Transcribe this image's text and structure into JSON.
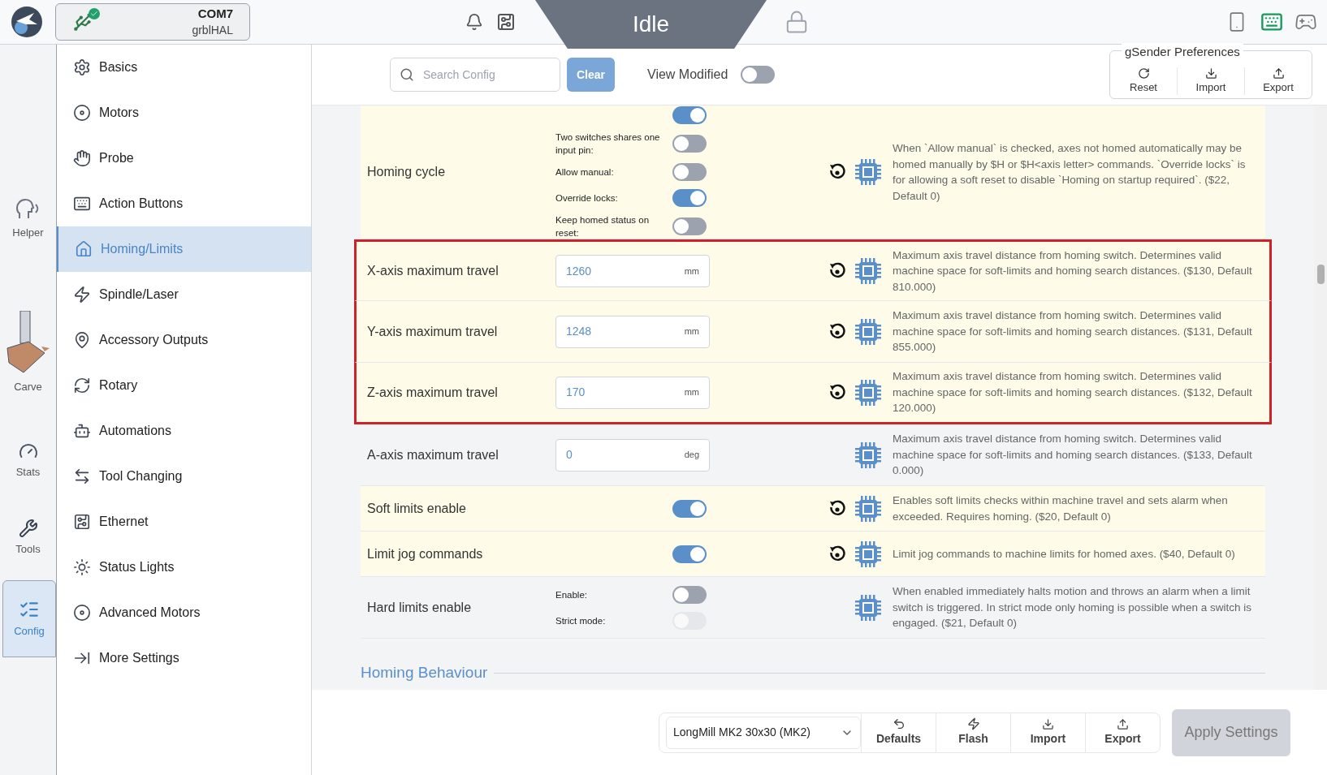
{
  "top_bar": {
    "port": "COM7",
    "firmware": "grblHAL",
    "status": "Idle"
  },
  "rail": [
    {
      "label": "Helper",
      "kind": "helper",
      "selected": false
    },
    {
      "label": "Carve",
      "kind": "carve",
      "selected": false
    },
    {
      "label": "Stats",
      "kind": "stats",
      "selected": false
    },
    {
      "label": "Tools",
      "kind": "tools",
      "selected": false
    },
    {
      "label": "Config",
      "kind": "config",
      "selected": true
    }
  ],
  "sidebar": {
    "items": [
      {
        "label": "Basics",
        "selected": false
      },
      {
        "label": "Motors",
        "selected": false
      },
      {
        "label": "Probe",
        "selected": false
      },
      {
        "label": "Action Buttons",
        "selected": false
      },
      {
        "label": "Homing/Limits",
        "selected": true
      },
      {
        "label": "Spindle/Laser",
        "selected": false
      },
      {
        "label": "Accessory Outputs",
        "selected": false
      },
      {
        "label": "Rotary",
        "selected": false
      },
      {
        "label": "Automations",
        "selected": false
      },
      {
        "label": "Tool Changing",
        "selected": false
      },
      {
        "label": "Ethernet",
        "selected": false
      },
      {
        "label": "Status Lights",
        "selected": false
      },
      {
        "label": "Advanced Motors",
        "selected": false
      },
      {
        "label": "More Settings",
        "selected": false
      }
    ]
  },
  "toolbar": {
    "search": {
      "placeholder": "Search Config"
    },
    "clear": "Clear",
    "view_modified": {
      "label": "View Modified",
      "on": false
    },
    "preferences": {
      "title": "gSender Preferences",
      "buttons": [
        "Reset",
        "Import",
        "Export"
      ]
    }
  },
  "settings": [
    {
      "kind": "toggles",
      "label": "Homing cycle",
      "modified": true,
      "highlighted": false,
      "options": [
        {
          "on": true,
          "disabled": false
        },
        {
          "label": "Two switches shares one input pin:",
          "on": false,
          "disabled": false
        },
        {
          "label": "Allow manual:",
          "on": false,
          "disabled": false
        },
        {
          "label": "Override locks:",
          "on": true,
          "disabled": false
        },
        {
          "label": "Keep homed status on reset:",
          "on": false,
          "disabled": false
        }
      ],
      "description": "When `Allow manual` is checked, axes not homed automatically may be homed manually by $H or $H<axis letter> commands. `Override locks` is for allowing a soft reset to disable `Homing on startup required`. ($22, Default 0)"
    },
    {
      "kind": "number",
      "label": "X-axis maximum travel",
      "modified": true,
      "highlighted": true,
      "value": "1260",
      "unit": "mm",
      "description": "Maximum axis travel distance from homing switch. Determines valid machine space for soft-limits and homing search distances. ($130, Default 810.000)"
    },
    {
      "kind": "number",
      "label": "Y-axis maximum travel",
      "modified": true,
      "highlighted": true,
      "value": "1248",
      "unit": "mm",
      "description": "Maximum axis travel distance from homing switch. Determines valid machine space for soft-limits and homing search distances. ($131, Default 855.000)"
    },
    {
      "kind": "number",
      "label": "Z-axis maximum travel",
      "modified": true,
      "highlighted": true,
      "value": "170",
      "unit": "mm",
      "description": "Maximum axis travel distance from homing switch. Determines valid machine space for soft-limits and homing search distances. ($132, Default 120.000)"
    },
    {
      "kind": "number",
      "label": "A-axis maximum travel",
      "modified": false,
      "highlighted": false,
      "value": "0",
      "unit": "deg",
      "description": "Maximum axis travel distance from homing switch. Determines valid machine space for soft-limits and homing search distances. ($133, Default 0.000)"
    },
    {
      "kind": "toggle",
      "label": "Soft limits enable",
      "modified": true,
      "highlighted": false,
      "on": true,
      "description": "Enables soft limits checks within machine travel and sets alarm when exceeded. Requires homing. ($20, Default 0)"
    },
    {
      "kind": "toggle",
      "label": "Limit jog commands",
      "modified": true,
      "highlighted": false,
      "on": true,
      "description": "Limit jog commands to machine limits for homed axes. ($40, Default 0)"
    },
    {
      "kind": "toggles",
      "label": "Hard limits enable",
      "modified": false,
      "highlighted": false,
      "options": [
        {
          "label": "Enable:",
          "on": false,
          "disabled": false
        },
        {
          "label": "Strict mode:",
          "on": false,
          "disabled": true
        }
      ],
      "description": "When enabled immediately halts motion and throws an alarm when a limit switch is triggered. In strict mode only homing is possible when a switch is engaged. ($21, Default 0)"
    }
  ],
  "section_heading": "Homing Behaviour",
  "footer": {
    "profile": "LongMill MK2 30x30 (MK2)",
    "buttons": [
      "Defaults",
      "Flash",
      "Import",
      "Export"
    ],
    "apply": {
      "label": "Apply Settings",
      "disabled": true
    }
  }
}
